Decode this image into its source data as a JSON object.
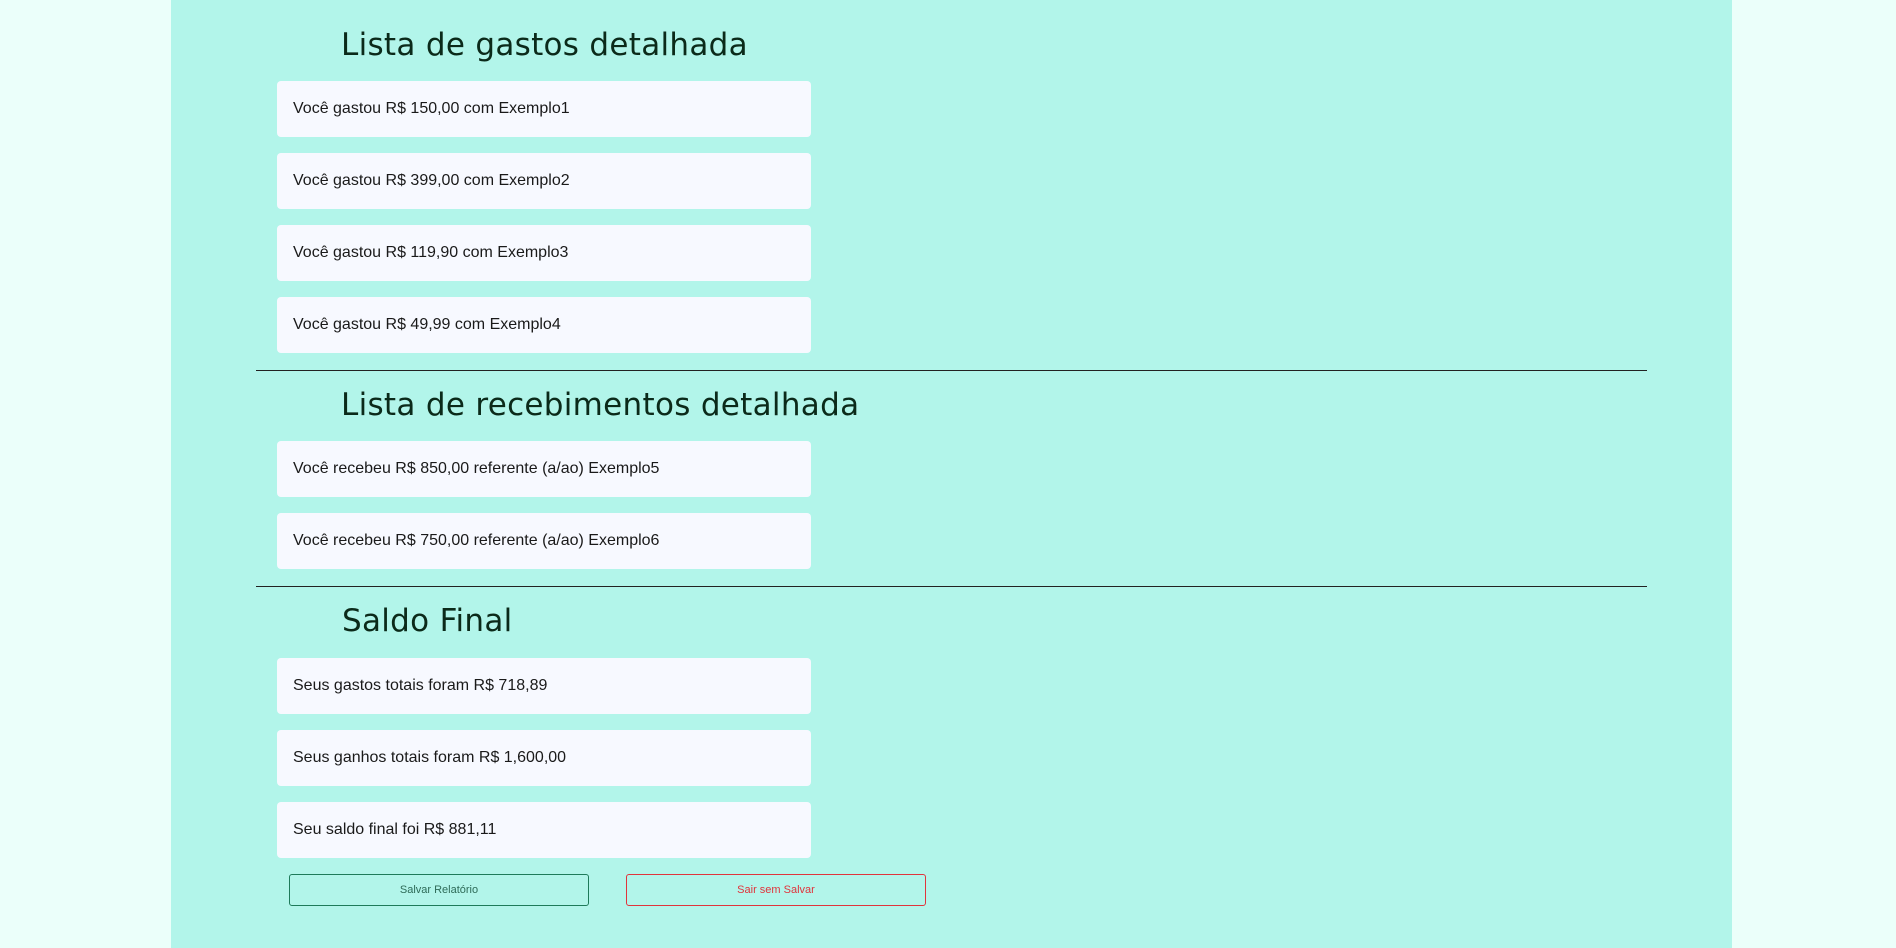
{
  "expenses": {
    "title": "Lista de gastos detalhada",
    "items": [
      "Você gastou R$ 150,00 com Exemplo1",
      "Você gastou R$ 399,00 com Exemplo2",
      "Você gastou R$ 119,90 com Exemplo3",
      "Você gastou R$ 49,99 com Exemplo4"
    ]
  },
  "income": {
    "title": "Lista de recebimentos detalhada",
    "items": [
      "Você recebeu R$ 850,00 referente (a/ao) Exemplo5",
      "Você recebeu R$ 750,00 referente (a/ao) Exemplo6"
    ]
  },
  "balance": {
    "title": "Saldo Final",
    "items": [
      "Seus gastos totais foram R$ 718,89",
      "Seus ganhos totais foram R$ 1,600,00",
      "Seu saldo final foi R$ 881,11"
    ]
  },
  "actions": {
    "save_label": "Salvar Relatório",
    "exit_label": "Sair sem Salvar"
  },
  "colors": {
    "page_bg": "#ebfffa",
    "panel_bg": "#b2f5ea",
    "card_bg": "#f7f9ff",
    "save_border": "#1e7a5a",
    "exit_border": "#e0343c"
  }
}
